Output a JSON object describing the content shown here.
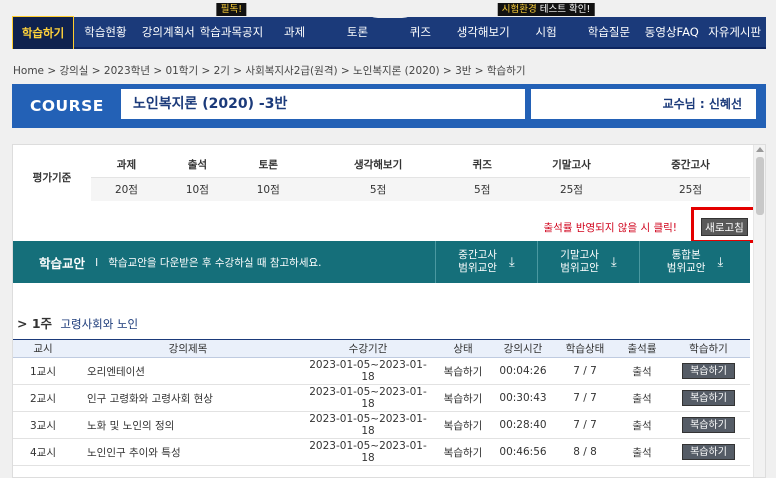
{
  "nav": {
    "items": [
      "학습하기",
      "학습현황",
      "강의계획서",
      "학습과목공지",
      "과제",
      "토론",
      "퀴즈",
      "생각해보기",
      "시험",
      "학습질문",
      "동영상FAQ",
      "자유게시판"
    ],
    "tag_notice": "필독!",
    "tag_exam_y": "시험환경",
    "tag_exam_w": " 테스트 확인!"
  },
  "breadcrumb": "Home > 강의실 > 2023학년 > 01학기 > 2기 > 사회복지사2급(원격) > 노인복지론 (2020) > 3반 > 학습하기",
  "course": {
    "label": "COURSE",
    "title": "노인복지론 (2020) -3반",
    "professor": "교수님 : 신혜선"
  },
  "evaluation": {
    "row_label": "평가기준",
    "headers": [
      "과제",
      "출석",
      "토론",
      "생각해보기",
      "퀴즈",
      "기말고사",
      "중간고사"
    ],
    "values": [
      "20점",
      "10점",
      "10점",
      "5점",
      "5점",
      "25점",
      "25점"
    ]
  },
  "refresh": {
    "note": "출석률 반영되지 않을 시 클릭!",
    "button": "새로고침"
  },
  "materials": {
    "title": "학습교안",
    "separator": "I",
    "desc": "학습교안을 다운받은 후 수강하실 때 참고하세요.",
    "buttons": [
      {
        "l1": "중간고사",
        "l2": "범위교안"
      },
      {
        "l1": "기말고사",
        "l2": "범위교안"
      },
      {
        "l1": "통합본",
        "l2": "범위교안"
      }
    ],
    "download_icon": "download-icon"
  },
  "week": {
    "marker": ">",
    "label": "1주",
    "title": "고령사회와 노인"
  },
  "lectures": {
    "headers": [
      "교시",
      "강의제목",
      "수강기간",
      "상태",
      "강의시간",
      "학습상태",
      "출석률",
      "학습하기"
    ],
    "rows": [
      {
        "no": "1교시",
        "title": "오리엔테이션",
        "period": "2023-01-05~2023-01-18",
        "status": "복습하기",
        "time": "00:04:26",
        "progress": "7 / 7",
        "attend": "출석",
        "btn": "복습하기"
      },
      {
        "no": "2교시",
        "title": "인구 고령화와 고령사회 현상",
        "period": "2023-01-05~2023-01-18",
        "status": "복습하기",
        "time": "00:30:43",
        "progress": "7 / 7",
        "attend": "출석",
        "btn": "복습하기"
      },
      {
        "no": "3교시",
        "title": "노화 및 노인의 정의",
        "period": "2023-01-05~2023-01-18",
        "status": "복습하기",
        "time": "00:28:40",
        "progress": "7 / 7",
        "attend": "출석",
        "btn": "복습하기"
      },
      {
        "no": "4교시",
        "title": "노인인구 추이와 특성",
        "period": "2023-01-05~2023-01-18",
        "status": "복습하기",
        "time": "00:46:56",
        "progress": "8 / 8",
        "attend": "출석",
        "btn": "복습하기"
      }
    ]
  }
}
